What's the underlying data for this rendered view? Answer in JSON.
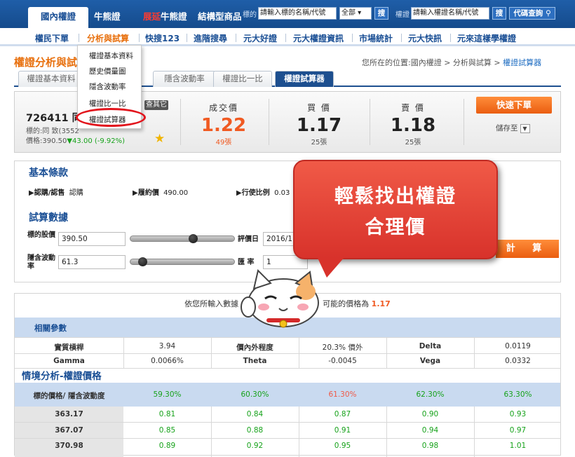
{
  "topnav": {
    "tabs": [
      "國內權證",
      "牛熊證",
      "展延",
      "牛熊證",
      "結構型商品"
    ],
    "underlying_label": "標的",
    "underlying_placeholder": "請輸入標的名稱/代號",
    "market_select": "全部 ▾",
    "search_label": "搜",
    "warrant_label": "權證",
    "warrant_placeholder": "請輸入權證名稱/代號",
    "search2_label": "搜",
    "code_lookup": "代碼查詢"
  },
  "subnav": {
    "items": [
      "權民下單",
      "分析與試算",
      "快搜123",
      "進階搜尋",
      "元大好證",
      "元大權證資訊",
      "市場統計",
      "元大快訊",
      "元來這樣學權證"
    ]
  },
  "dropdown": {
    "items": [
      "權證基本資料",
      "歷史價量圖",
      "隱含波動率",
      "權證比一比",
      "權證試算器"
    ]
  },
  "page": {
    "title": "權證分析與試",
    "breadcrumb_prefix": "您所在的位置:國內權證 > 分析與試算 > ",
    "breadcrumb_current": "權證試算器"
  },
  "tabs": [
    "權證基本資料",
    "隱含波動率",
    "權證比一比",
    "權證試算器"
  ],
  "quote": {
    "name": "726411 同致",
    "underlying": "標的:同 致(3552",
    "price_text": "價格:390.50",
    "change": "▼43.00 (-9.92%)",
    "badge": "查其它",
    "last_label": "成交價",
    "last_value": "1.22",
    "last_volume": "49張",
    "bid_label": "買 價",
    "bid_value": "1.17",
    "bid_volume": "25張",
    "ask_label": "賣 價",
    "ask_value": "1.18",
    "ask_volume": "25張",
    "quick_order": "快速下單",
    "save_to": "儲存至"
  },
  "basic": {
    "title": "基本條款",
    "type_label": "▶認購/認售",
    "type_value": "認購",
    "strike_label": "▶履約價",
    "strike_value": "490.00",
    "ratio_label": "▶行使比例",
    "ratio_value": "0.03"
  },
  "calc": {
    "title": "試算數據",
    "price_label": "標的股價",
    "price_value": "390.50",
    "date_label": "評價日",
    "date_value": "2016/11/3",
    "iv_label": "隱含波動率",
    "iv_value": "61.3",
    "rate_label": "匯 率",
    "rate_value": "1",
    "calc_button": "計 算",
    "price_slider_level": 0.6,
    "iv_slider_level": 0.12
  },
  "callout": {
    "line1": "輕鬆找出權證",
    "line2": "合理價"
  },
  "results": {
    "summary_prefix": "依您所輸入數據",
    "summary_suffix": "可能的價格為",
    "fair_value": "1.17",
    "params_title": "相關參數",
    "params": [
      [
        "實質槓桿",
        "3.94",
        "價內外程度",
        "20.3% 價外",
        "Delta",
        "0.0119"
      ],
      [
        "Gamma",
        "0.0066%",
        "Theta",
        "-0.0045",
        "Vega",
        "0.0332"
      ]
    ],
    "scenario_title": "情境分析-權證價格",
    "header": [
      "標的價格/ 隱含波動度",
      "59.30%",
      "60.30%",
      "61.30%",
      "62.30%",
      "63.30%"
    ],
    "rows": [
      [
        "363.17",
        "0.81",
        "0.84",
        "0.87",
        "0.90",
        "0.93"
      ],
      [
        "367.07",
        "0.85",
        "0.88",
        "0.91",
        "0.94",
        "0.97"
      ],
      [
        "370.98",
        "0.89",
        "0.92",
        "0.95",
        "0.98",
        "1.01"
      ]
    ]
  }
}
